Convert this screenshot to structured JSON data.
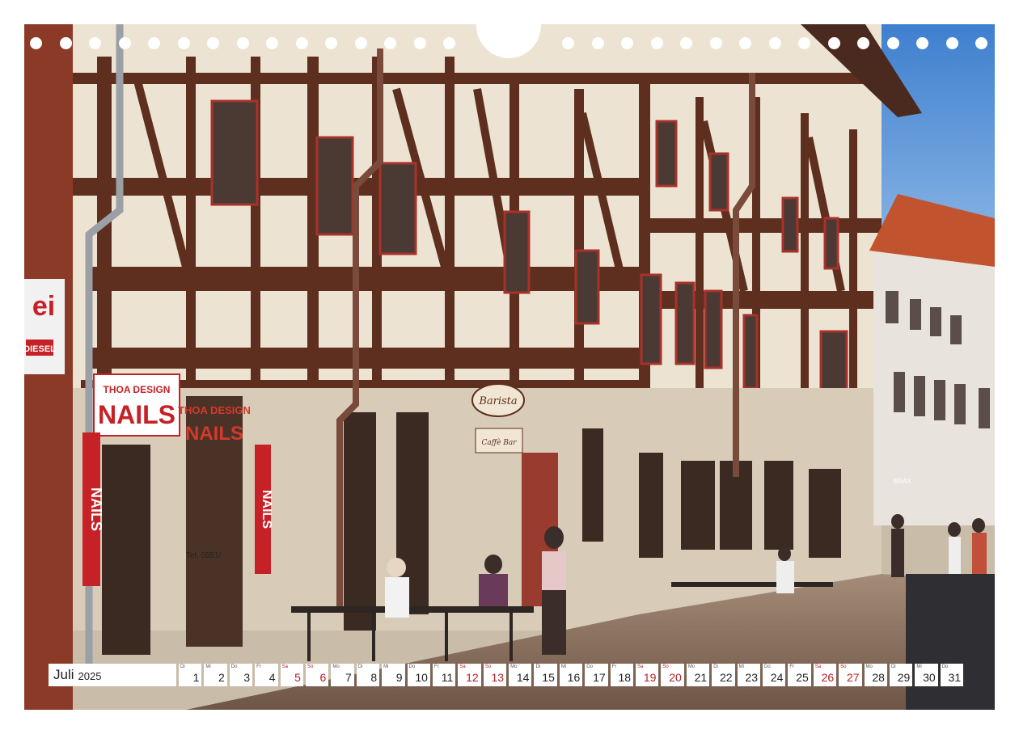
{
  "sign_texts": {
    "nails_sign_brand": "THOA DESIGN",
    "nails_sign_main": "NAILS",
    "window_brand": "THOA DESIGN",
    "window_main": "NAILS",
    "vertical_left": "NAILS",
    "vertical_right": "NAILS",
    "cafe_sign": "Barista",
    "cafe_board": "Caffè Bar",
    "left_sign_top": "ei",
    "left_sign_bottom": "DIESEL",
    "phone_number": "Tel. 0551/",
    "shop_far": "BRAX"
  },
  "calendar": {
    "month": "Juli",
    "year": "2025",
    "days": [
      {
        "abbr": "Di",
        "num": "1",
        "weekend": false
      },
      {
        "abbr": "Mi",
        "num": "2",
        "weekend": false
      },
      {
        "abbr": "Do",
        "num": "3",
        "weekend": false
      },
      {
        "abbr": "Fr",
        "num": "4",
        "weekend": false
      },
      {
        "abbr": "Sa",
        "num": "5",
        "weekend": true
      },
      {
        "abbr": "So",
        "num": "6",
        "weekend": true
      },
      {
        "abbr": "Mo",
        "num": "7",
        "weekend": false
      },
      {
        "abbr": "Di",
        "num": "8",
        "weekend": false
      },
      {
        "abbr": "Mi",
        "num": "9",
        "weekend": false
      },
      {
        "abbr": "Do",
        "num": "10",
        "weekend": false
      },
      {
        "abbr": "Fr",
        "num": "11",
        "weekend": false
      },
      {
        "abbr": "Sa",
        "num": "12",
        "weekend": true
      },
      {
        "abbr": "So",
        "num": "13",
        "weekend": true
      },
      {
        "abbr": "Mo",
        "num": "14",
        "weekend": false
      },
      {
        "abbr": "Di",
        "num": "15",
        "weekend": false
      },
      {
        "abbr": "Mi",
        "num": "16",
        "weekend": false
      },
      {
        "abbr": "Do",
        "num": "17",
        "weekend": false
      },
      {
        "abbr": "Fr",
        "num": "18",
        "weekend": false
      },
      {
        "abbr": "Sa",
        "num": "19",
        "weekend": true
      },
      {
        "abbr": "So",
        "num": "20",
        "weekend": true
      },
      {
        "abbr": "Mo",
        "num": "21",
        "weekend": false
      },
      {
        "abbr": "Di",
        "num": "22",
        "weekend": false
      },
      {
        "abbr": "Mi",
        "num": "23",
        "weekend": false
      },
      {
        "abbr": "Do",
        "num": "24",
        "weekend": false
      },
      {
        "abbr": "Fr",
        "num": "25",
        "weekend": false
      },
      {
        "abbr": "Sa",
        "num": "26",
        "weekend": true
      },
      {
        "abbr": "So",
        "num": "27",
        "weekend": true
      },
      {
        "abbr": "Mo",
        "num": "28",
        "weekend": false
      },
      {
        "abbr": "Di",
        "num": "29",
        "weekend": false
      },
      {
        "abbr": "Mi",
        "num": "30",
        "weekend": false
      },
      {
        "abbr": "Do",
        "num": "31",
        "weekend": false
      }
    ]
  },
  "colors": {
    "timber": "#5e2f1e",
    "plaster": "#ede3d2",
    "sky": "#4f8fd6",
    "roof": "#c1542f",
    "sign_red": "#c62126",
    "weekend_red": "#b41f24"
  }
}
